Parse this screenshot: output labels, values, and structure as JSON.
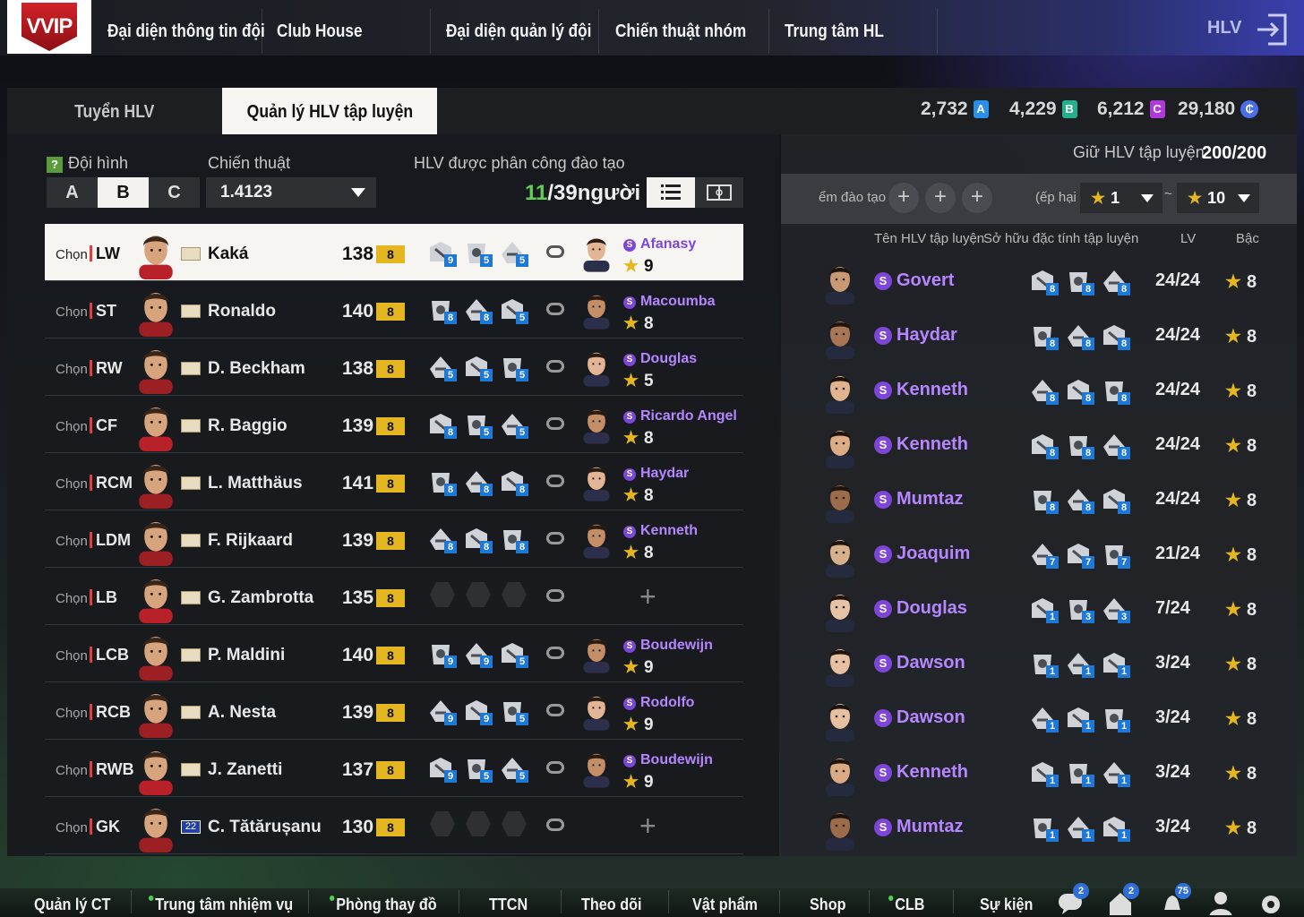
{
  "logo": {
    "text": "VVIP"
  },
  "topnav": {
    "items": [
      "Đại diện thông tin đội",
      "Club House",
      "Đại diện quản lý đội",
      "Chiến thuật nhóm",
      "Trung tâm HL"
    ],
    "user_label": "HLV"
  },
  "tabs": {
    "tab1": "Tuyển HLV",
    "tab2": "Quản lý HLV tập luyện"
  },
  "currencies": [
    {
      "value": "2,732",
      "badge": "A",
      "color": "#2a8fe6"
    },
    {
      "value": "4,229",
      "badge": "B",
      "color": "#23b08a"
    },
    {
      "value": "6,212",
      "badge": "C",
      "color": "#b03ad8"
    },
    {
      "value": "29,180",
      "badge": "₵",
      "color": "#4a6ee6"
    }
  ],
  "left": {
    "formation_label": "Đội hình",
    "tactic_label": "Chiến thuật",
    "assigned_label": "HLV được phân công đào tạo cầu t",
    "formation_options": [
      "A",
      "B",
      "C"
    ],
    "formation_selected": "B",
    "tactic_value": "1.4123",
    "assigned_current": "11",
    "assigned_rest": "/39người",
    "select_label": "Chọn"
  },
  "players": [
    {
      "pos": "LW",
      "name": "Kaká",
      "ovr": "138",
      "lvl": "8",
      "traits": [
        "9",
        "5",
        "5"
      ],
      "coach": "Afanasy",
      "coach_lvl": "9",
      "selected": true,
      "card": ""
    },
    {
      "pos": "ST",
      "name": "Ronaldo",
      "ovr": "140",
      "lvl": "8",
      "traits": [
        "8",
        "8",
        "5"
      ],
      "coach": "Macoumba",
      "coach_lvl": "8",
      "card": ""
    },
    {
      "pos": "RW",
      "name": "D. Beckham",
      "ovr": "138",
      "lvl": "8",
      "traits": [
        "5",
        "5",
        "5"
      ],
      "coach": "Douglas",
      "coach_lvl": "5",
      "card": ""
    },
    {
      "pos": "CF",
      "name": "R. Baggio",
      "ovr": "139",
      "lvl": "8",
      "traits": [
        "8",
        "5",
        "5"
      ],
      "coach": "Ricardo Angel",
      "coach_lvl": "8",
      "card": ""
    },
    {
      "pos": "RCM",
      "name": "L. Matthäus",
      "ovr": "141",
      "lvl": "8",
      "traits": [
        "8",
        "8",
        "8"
      ],
      "coach": "Haydar",
      "coach_lvl": "8",
      "card": ""
    },
    {
      "pos": "LDM",
      "name": "F. Rijkaard",
      "ovr": "139",
      "lvl": "8",
      "traits": [
        "8",
        "8",
        "8"
      ],
      "coach": "Kenneth",
      "coach_lvl": "8",
      "card": ""
    },
    {
      "pos": "LB",
      "name": "G. Zambrotta",
      "ovr": "135",
      "lvl": "8",
      "traits": [],
      "coach": "",
      "coach_lvl": "",
      "card": ""
    },
    {
      "pos": "LCB",
      "name": "P. Maldini",
      "ovr": "140",
      "lvl": "8",
      "traits": [
        "9",
        "9",
        "5"
      ],
      "coach": "Boudewijn",
      "coach_lvl": "9",
      "card": ""
    },
    {
      "pos": "RCB",
      "name": "A. Nesta",
      "ovr": "139",
      "lvl": "8",
      "traits": [
        "9",
        "9",
        "5"
      ],
      "coach": "Rodolfo",
      "coach_lvl": "9",
      "card": ""
    },
    {
      "pos": "RWB",
      "name": "J. Zanetti",
      "ovr": "137",
      "lvl": "8",
      "traits": [
        "9",
        "5",
        "5"
      ],
      "coach": "Boudewijn",
      "coach_lvl": "9",
      "card": ""
    },
    {
      "pos": "GK",
      "name": "C. Tătărușanu",
      "ovr": "130",
      "lvl": "8",
      "traits": [],
      "coach": "",
      "coach_lvl": "",
      "card": "22"
    }
  ],
  "right": {
    "hold_label": "Giữ HLV tập luyện",
    "hold_value": "200/200",
    "filter_label": "ểm đào tạo",
    "rank_label": "(ếp hại",
    "rank_from": "1",
    "rank_sep": "~",
    "rank_to": "10",
    "col_name": "Tên HLV tập luyện",
    "col_traits": "Sở hữu đặc tính tập luyện",
    "col_lv": "LV",
    "col_rank": "Bậc"
  },
  "coaches": [
    {
      "name": "Govert",
      "traits": [
        "8",
        "8",
        "8"
      ],
      "lv": "24/24",
      "rank": "8"
    },
    {
      "name": "Haydar",
      "traits": [
        "8",
        "8",
        "8"
      ],
      "lv": "24/24",
      "rank": "8"
    },
    {
      "name": "Kenneth",
      "traits": [
        "8",
        "8",
        "8"
      ],
      "lv": "24/24",
      "rank": "8"
    },
    {
      "name": "Kenneth",
      "traits": [
        "8",
        "8",
        "8"
      ],
      "lv": "24/24",
      "rank": "8"
    },
    {
      "name": "Mumtaz",
      "traits": [
        "8",
        "8",
        "8"
      ],
      "lv": "24/24",
      "rank": "8"
    },
    {
      "name": "Joaquim",
      "traits": [
        "7",
        "7",
        "7"
      ],
      "lv": "21/24",
      "rank": "8"
    },
    {
      "name": "Douglas",
      "traits": [
        "1",
        "3",
        "3"
      ],
      "lv": "7/24",
      "rank": "8"
    },
    {
      "name": "Dawson",
      "traits": [
        "1",
        "1",
        "1"
      ],
      "lv": "3/24",
      "rank": "8"
    },
    {
      "name": "Dawson",
      "traits": [
        "1",
        "1",
        "1"
      ],
      "lv": "3/24",
      "rank": "8"
    },
    {
      "name": "Kenneth",
      "traits": [
        "1",
        "1",
        "1"
      ],
      "lv": "3/24",
      "rank": "8"
    },
    {
      "name": "Mumtaz",
      "traits": [
        "1",
        "1",
        "1"
      ],
      "lv": "3/24",
      "rank": "8"
    }
  ],
  "bottomnav": {
    "items": [
      "Quản lý CT",
      "Trung tâm nhiệm vụ",
      "Phòng thay đồ",
      "TTCN",
      "Theo dõi",
      "Vật phẩm",
      "Shop",
      "CLB",
      "Sự kiện"
    ],
    "badges": [
      "2",
      "2",
      "75"
    ]
  }
}
